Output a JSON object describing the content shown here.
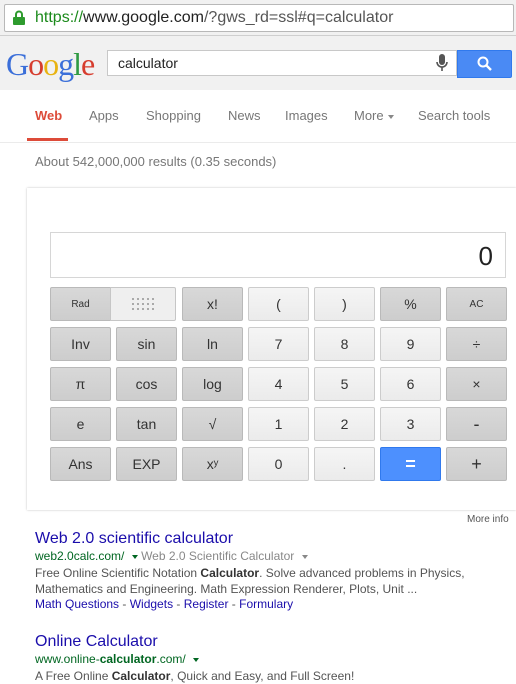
{
  "browser": {
    "scheme": "https://",
    "host": "www.google.com",
    "path": "/?gws_rd=ssl#q=calculator"
  },
  "header": {
    "logo": "Google",
    "query": "calculator"
  },
  "nav": {
    "tabs": [
      "Web",
      "Apps",
      "Shopping",
      "News",
      "Images",
      "More",
      "Search tools"
    ]
  },
  "results_count": "About 542,000,000 results (0.35 seconds)",
  "calculator": {
    "display": "0",
    "keys": [
      [
        "Rad",
        "",
        "x!",
        "(",
        ")",
        "%",
        "AC"
      ],
      [
        "Inv",
        "sin",
        "ln",
        "7",
        "8",
        "9",
        "÷"
      ],
      [
        "π",
        "cos",
        "log",
        "4",
        "5",
        "6",
        "×"
      ],
      [
        "e",
        "tan",
        "√",
        "1",
        "2",
        "3",
        "-"
      ],
      [
        "Ans",
        "EXP",
        "xʸ",
        "0",
        ".",
        "=",
        "+"
      ]
    ],
    "more_info": "More info"
  },
  "results": [
    {
      "title": "Web 2.0 scientific calculator",
      "url": "web2.0calc.com/",
      "crumb": "Web 2.0 Scientific Calculator",
      "snippet_1a": "Free Online Scientific Notation ",
      "snippet_1b": "Calculator",
      "snippet_1c": ". Solve advanced problems in Physics,",
      "snippet_2": "Mathematics and Engineering. Math Expression Renderer, Plots, Unit ...",
      "links": [
        "Math Questions",
        "Widgets",
        "Register",
        "Formulary"
      ]
    },
    {
      "title": "Online Calculator",
      "url_a": "www.online-",
      "url_b": "calculator",
      "url_c": ".com/",
      "snippet_a": "A Free Online ",
      "snippet_b": "Calculator",
      "snippet_c": ", Quick and Easy, and Full Screen!"
    }
  ]
}
